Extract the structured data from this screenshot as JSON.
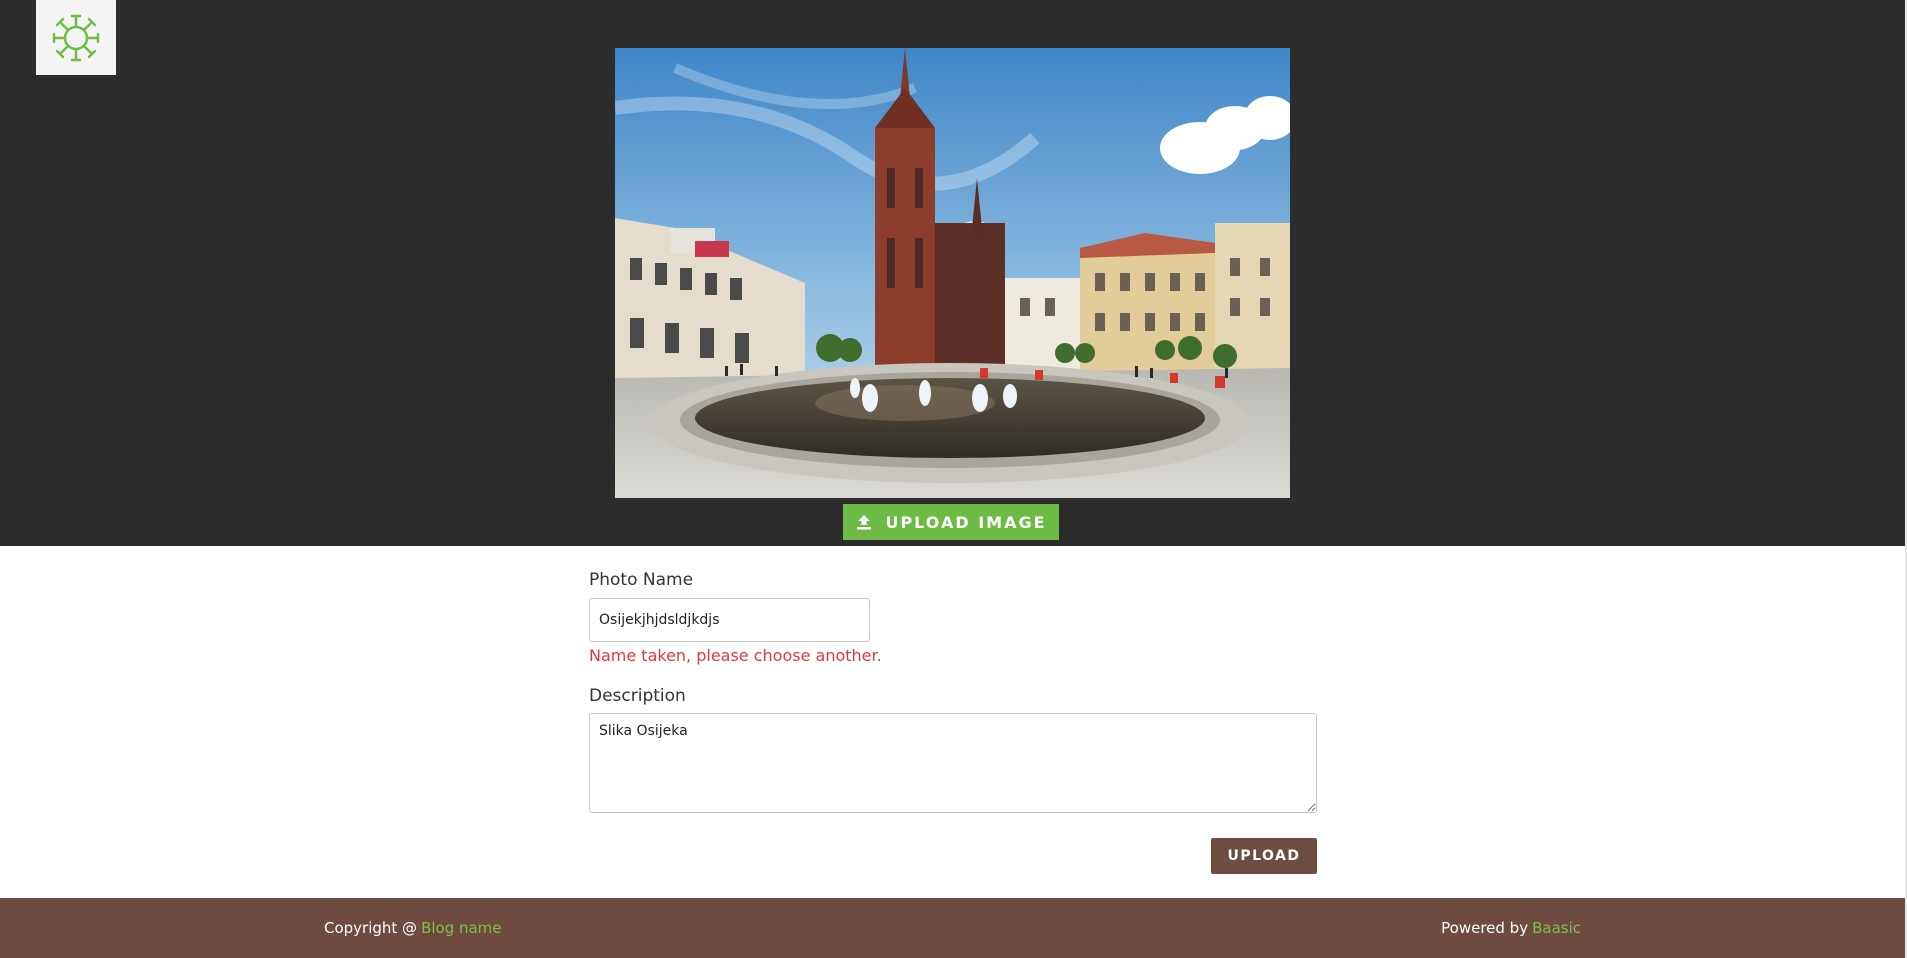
{
  "header": {
    "logo_icon": "sun-logo-icon",
    "photo_alt": "",
    "upload_image_label": "UPLOAD IMAGE",
    "upload_icon": "upload-arrow-icon"
  },
  "form": {
    "photo_name_label": "Photo Name",
    "photo_name_value": "Osijekjhjdsldjkdjs",
    "photo_name_error": "Name taken, please choose another.",
    "description_label": "Description",
    "description_value": "Slika Osijeka",
    "upload_label": "UPLOAD"
  },
  "footer": {
    "copyright_prefix": "Copyright @",
    "blog_name_link": "Blog name",
    "powered_by_prefix": "Powered by",
    "baasic_link": "Baasic"
  },
  "colors": {
    "hero_bg": "#2c2c2c",
    "accent_green": "#6dbb45",
    "brown": "#6d4c41",
    "footer_bg": "#6f4a3f",
    "error_red": "#e53935"
  }
}
